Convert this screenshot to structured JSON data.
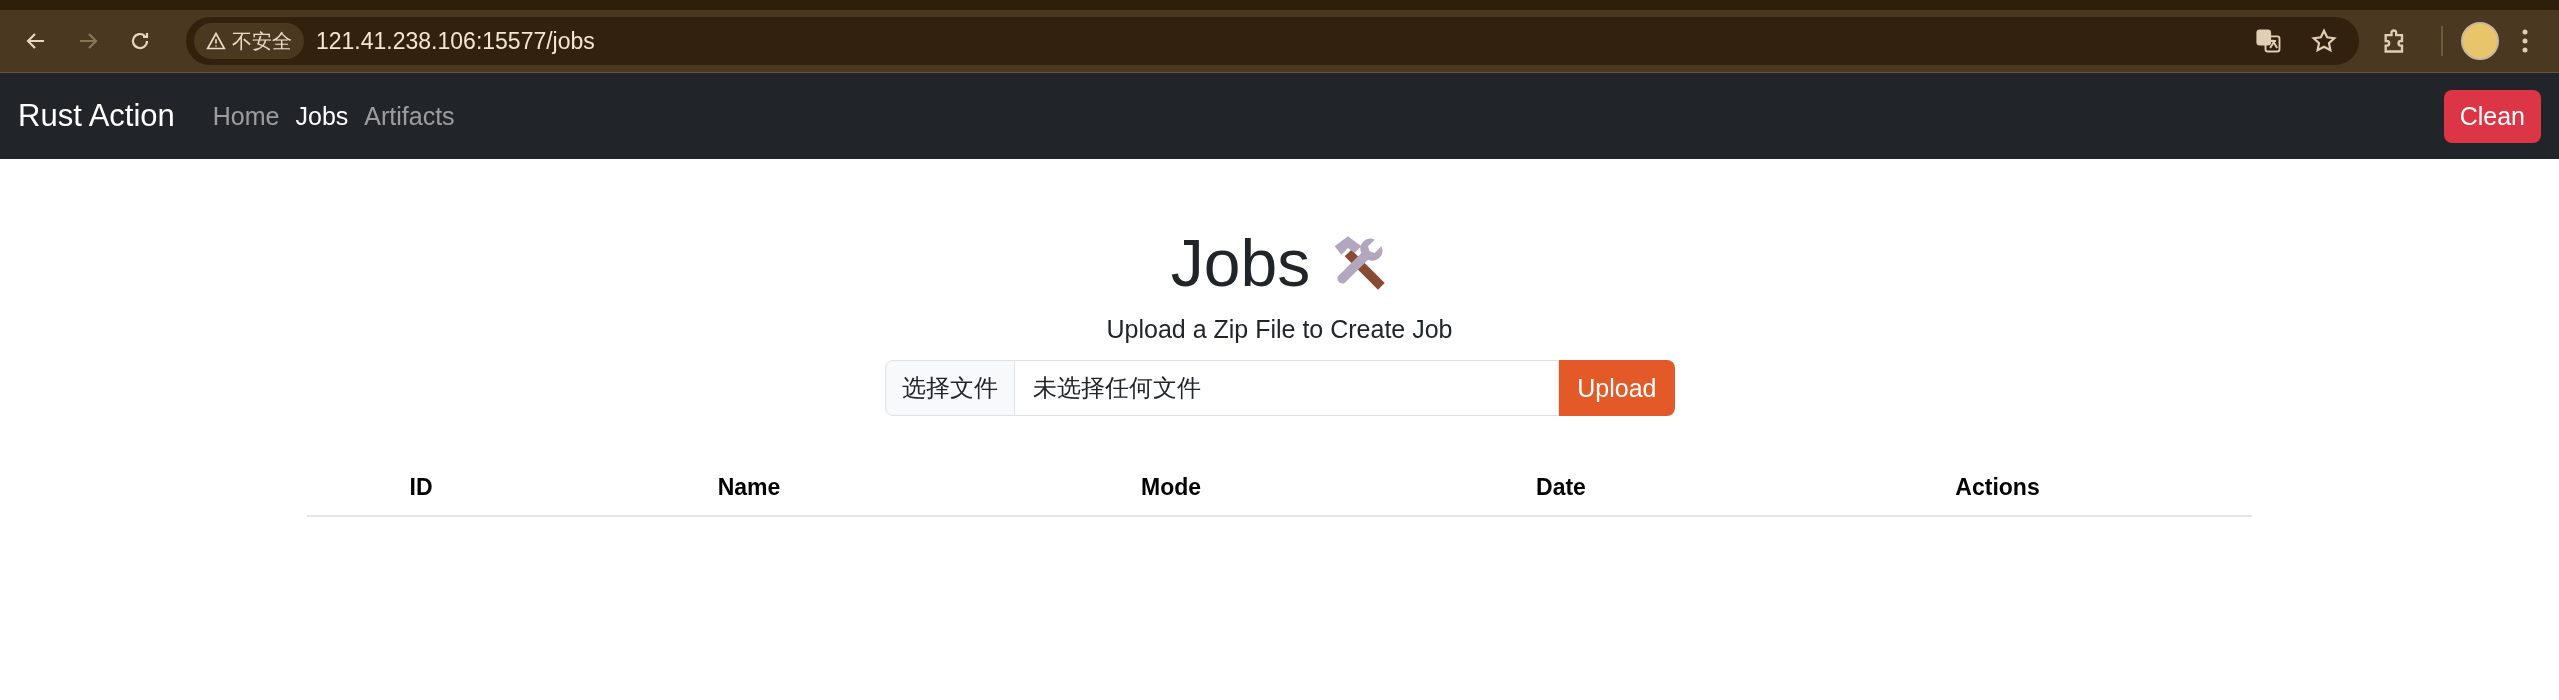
{
  "browser": {
    "nav_buttons": [
      {
        "kind": "back",
        "disabled": false
      },
      {
        "kind": "forward",
        "disabled": true
      },
      {
        "kind": "reload",
        "disabled": false
      }
    ],
    "security_label": "不安全",
    "url": "121.41.238.106:15577/jobs"
  },
  "navbar": {
    "brand": "Rust Action",
    "links": [
      {
        "label": "Home",
        "selected": false
      },
      {
        "label": "Jobs",
        "selected": true
      },
      {
        "label": "Artifacts",
        "selected": false
      }
    ],
    "action_button": "Clean"
  },
  "main": {
    "title": "Jobs",
    "subtitle": "Upload a Zip File to Create Job",
    "upload": {
      "choose_button": "选择文件",
      "file_status": "未选择任何文件",
      "submit_button": "Upload"
    },
    "table": {
      "columns": [
        "ID",
        "Name",
        "Mode",
        "Date",
        "Actions"
      ]
    }
  }
}
